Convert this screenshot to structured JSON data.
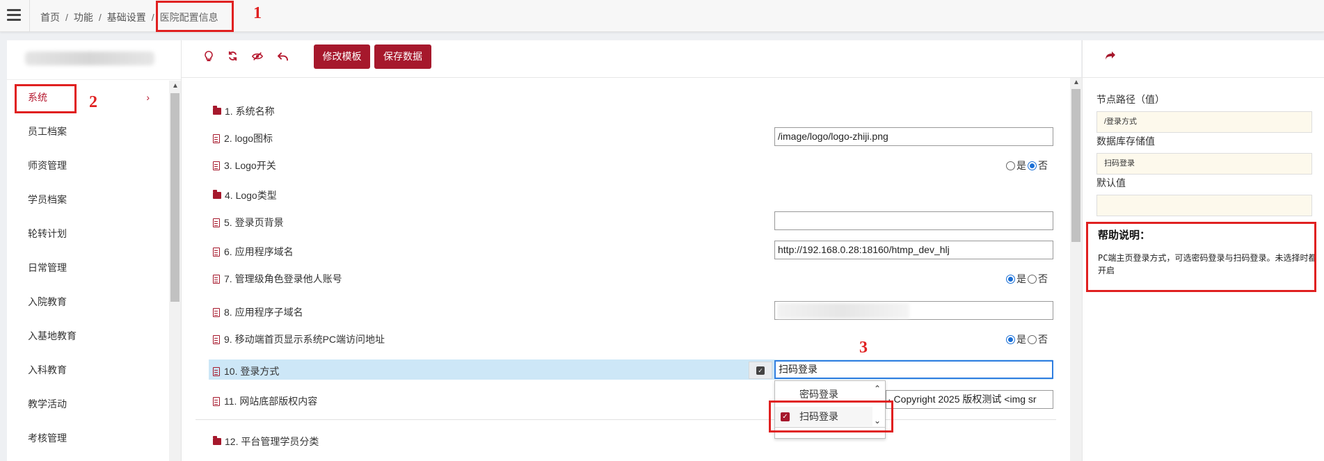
{
  "breadcrumb": {
    "items": [
      "首页",
      "功能",
      "基础设置"
    ],
    "current": "医院配置信息",
    "separator": "/"
  },
  "annotations": [
    "1",
    "2",
    "3"
  ],
  "sidebar": {
    "items": [
      {
        "label": "系统",
        "active": true
      },
      {
        "label": "员工档案"
      },
      {
        "label": "师资管理"
      },
      {
        "label": "学员档案"
      },
      {
        "label": "轮转计划"
      },
      {
        "label": "日常管理"
      },
      {
        "label": "入院教育"
      },
      {
        "label": "入基地教育"
      },
      {
        "label": "入科教育"
      },
      {
        "label": "教学活动"
      },
      {
        "label": "考核管理"
      }
    ],
    "active_chevron": "›"
  },
  "toolbar": {
    "icons": [
      "lightbulb-icon",
      "refresh-icon",
      "eye-slash-icon",
      "undo-icon"
    ],
    "modify_template_label": "修改模板",
    "save_data_label": "保存数据"
  },
  "config": {
    "rows": [
      {
        "label": "1. 系统名称",
        "icon": "folder-icon"
      },
      {
        "label": "2. logo图标",
        "icon": "file-icon",
        "value": "/image/logo/logo-zhiji.png"
      },
      {
        "label": "3. Logo开关",
        "icon": "file-icon",
        "options": [
          "是",
          "否"
        ],
        "selected": "否"
      },
      {
        "label": "4. Logo类型",
        "icon": "folder-icon"
      },
      {
        "label": "5. 登录页背景",
        "icon": "file-icon",
        "value": ""
      },
      {
        "label": "6. 应用程序域名",
        "icon": "file-icon",
        "value": "http://192.168.0.28:18160/htmp_dev_hlj"
      },
      {
        "label": "7. 管理级角色登录他人账号",
        "icon": "file-icon",
        "options": [
          "是",
          "否"
        ],
        "selected": "是"
      },
      {
        "label": "8. 应用程序子域名",
        "icon": "file-icon",
        "value": ""
      },
      {
        "label": "9. 移动端首页显示系统PC端访问地址",
        "icon": "file-icon",
        "options": [
          "是",
          "否"
        ],
        "selected": "是"
      },
      {
        "label": "10. 登录方式",
        "icon": "file-icon",
        "value": "扫码登录"
      },
      {
        "label": "11. 网站底部版权内容",
        "icon": "file-icon",
        "value": "· Copyright 2025 版权测试 <img sr"
      },
      {
        "label": "12. 平台管理学员分类",
        "icon": "folder-icon"
      }
    ]
  },
  "dropdown": {
    "options": [
      {
        "label": "密码登录",
        "checked": false
      },
      {
        "label": "扫码登录",
        "checked": true
      }
    ]
  },
  "detail": {
    "node_path_label": "节点路径（值）",
    "node_path_value": "/登录方式",
    "db_value_label": "数据库存储值",
    "db_value": "扫码登录",
    "default_label": "默认值",
    "default_value": "",
    "help_title": "帮助说明：",
    "help_text": "PC端主页登录方式，可选密码登录与扫码登录。未选择时都开启"
  },
  "colors": {
    "accent": "#a6182c",
    "highlight_row": "#cde7f7",
    "annotation": "#e02020",
    "radio": "#1a6fd6"
  }
}
